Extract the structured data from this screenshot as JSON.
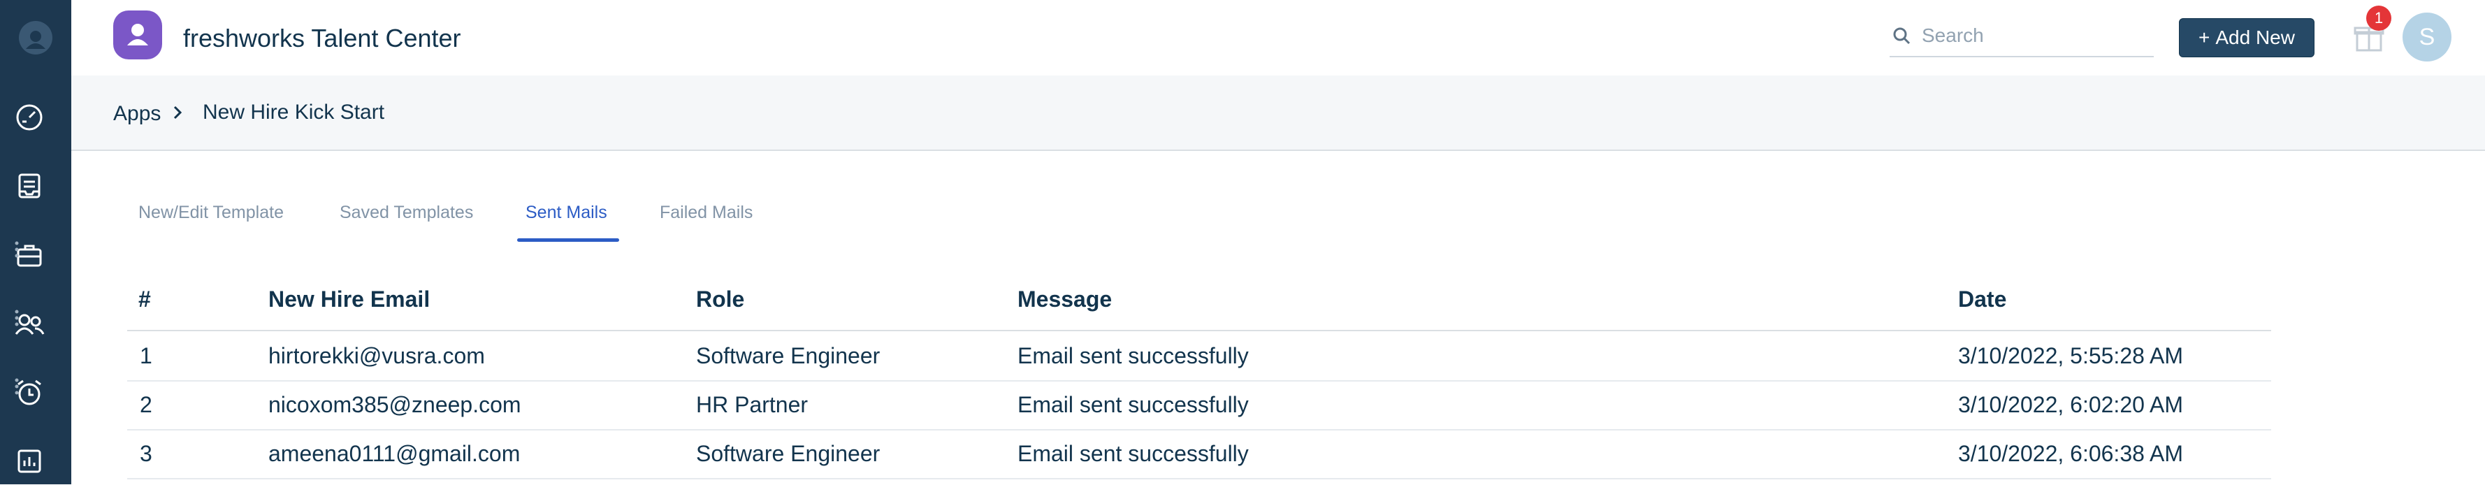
{
  "header": {
    "app_title": "freshworks Talent Center",
    "search_placeholder": "Search",
    "add_new_label": "Add New",
    "add_new_icon": "+",
    "notification_count": "1",
    "avatar_initial": "S"
  },
  "breadcrumb": {
    "root": "Apps",
    "current": "New Hire Kick Start"
  },
  "tabs": [
    {
      "label": "New/Edit Template",
      "active": false
    },
    {
      "label": "Saved Templates",
      "active": false
    },
    {
      "label": "Sent Mails",
      "active": true
    },
    {
      "label": "Failed Mails",
      "active": false
    }
  ],
  "table": {
    "columns": [
      "#",
      "New Hire Email",
      "Role",
      "Message",
      "Date"
    ],
    "rows": [
      [
        "1",
        "hirtorekki@vusra.com",
        "Software Engineer",
        "Email sent successfully",
        "3/10/2022, 5:55:28 AM"
      ],
      [
        "2",
        "nicoxom385@zneep.com",
        "HR Partner",
        "Email sent successfully",
        "3/10/2022, 6:02:20 AM"
      ],
      [
        "3",
        "ameena0111@gmail.com",
        "Software Engineer",
        "Email sent successfully",
        "3/10/2022, 6:06:38 AM"
      ]
    ]
  },
  "sidebar": {
    "items": [
      {
        "icon": "dashboard-icon"
      },
      {
        "icon": "inbox-icon"
      },
      {
        "icon": "briefcase-icon"
      },
      {
        "icon": "users-icon"
      },
      {
        "icon": "alarm-clock-icon"
      },
      {
        "icon": "reports-icon"
      }
    ]
  },
  "colors": {
    "sidebar_bg": "#1d3850",
    "brand_purple": "#7b57c7",
    "accent_blue": "#2c5cc5",
    "button_bg": "#264966",
    "badge_red": "#e43538"
  }
}
